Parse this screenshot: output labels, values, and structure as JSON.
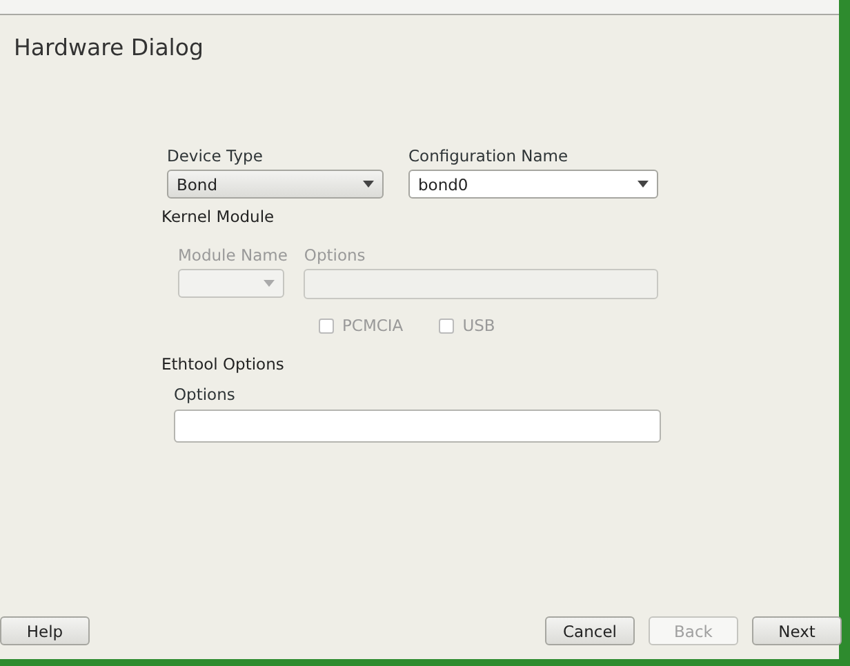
{
  "dialog": {
    "title": "Hardware Dialog"
  },
  "device_type": {
    "label": "Device Type",
    "value": "Bond",
    "disabled": false
  },
  "configuration_name": {
    "label": "Configuration Name",
    "value": "bond0",
    "disabled": false
  },
  "kernel_module": {
    "heading": "Kernel Module",
    "module_name": {
      "label": "Module Name",
      "disabled": true
    },
    "options": {
      "label": "Options",
      "disabled": true
    },
    "checkboxes": [
      {
        "label": "PCMCIA",
        "checked": false,
        "disabled": true
      },
      {
        "label": "USB",
        "checked": false,
        "disabled": true
      }
    ]
  },
  "ethtool": {
    "heading": "Ethtool Options",
    "options": {
      "label": "Options",
      "disabled": false
    }
  },
  "buttons": [
    {
      "label": "Help",
      "disabled": false,
      "kind": "left"
    },
    {
      "label": "Cancel",
      "disabled": false,
      "kind": "right"
    },
    {
      "label": "Back",
      "disabled": true,
      "kind": "right"
    },
    {
      "label": "Next",
      "disabled": false,
      "kind": "right"
    }
  ]
}
